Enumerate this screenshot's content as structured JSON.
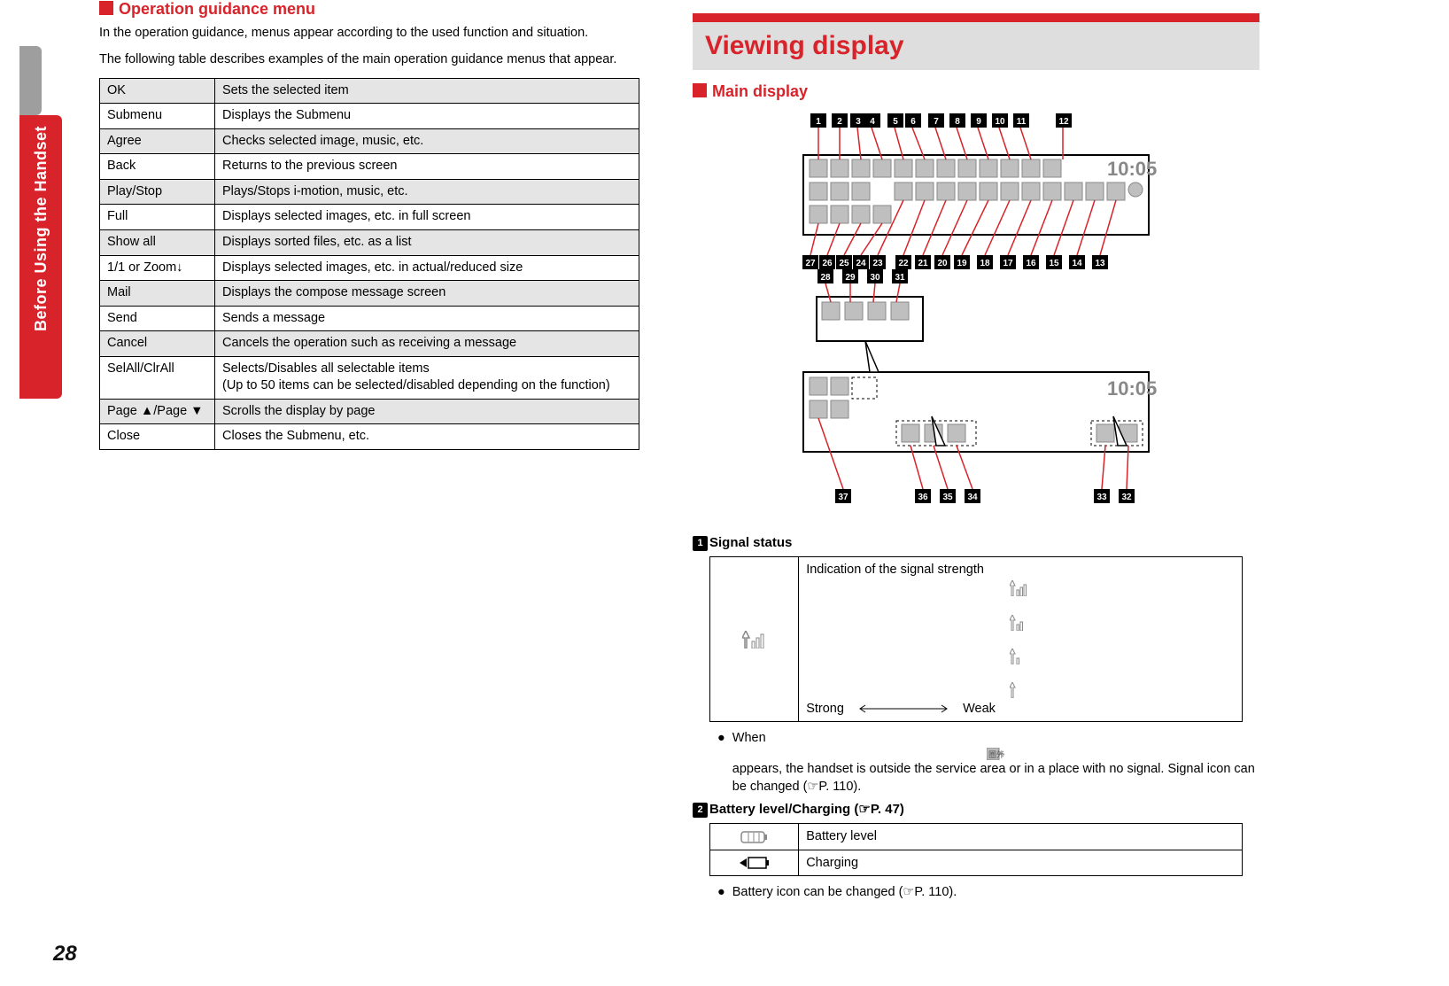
{
  "side_tab": "Before Using the Handset",
  "page_number": "28",
  "left": {
    "heading": "Operation guidance menu",
    "intro1": "In the operation guidance, menus appear according to the used function and situation.",
    "intro2": "The following table describes examples of the main operation guidance menus that appear.",
    "rows": [
      {
        "k": "OK",
        "v": "Sets the selected item"
      },
      {
        "k": "Submenu",
        "v": "Displays the Submenu"
      },
      {
        "k": "Agree",
        "v": "Checks selected image, music, etc."
      },
      {
        "k": "Back",
        "v": "Returns to the previous screen"
      },
      {
        "k": "Play/Stop",
        "v": "Plays/Stops i-motion, music, etc."
      },
      {
        "k": "Full",
        "v": "Displays selected images, etc. in full screen"
      },
      {
        "k": "Show all",
        "v": "Displays sorted files, etc. as a list"
      },
      {
        "k": "1/1 or Zoom↓",
        "v": "Displays selected images, etc. in actual/reduced size"
      },
      {
        "k": "Mail",
        "v": "Displays the compose message screen"
      },
      {
        "k": "Send",
        "v": "Sends a message"
      },
      {
        "k": "Cancel",
        "v": "Cancels the operation such as receiving a message"
      },
      {
        "k": "SelAll/ClrAll",
        "v": "Selects/Disables all selectable items\n(Up to 50 items can be selected/disabled depending on the function)"
      },
      {
        "k": "Page ▲/Page ▼",
        "v": "Scrolls the display by page"
      },
      {
        "k": "Close",
        "v": "Closes the Submenu, etc."
      }
    ]
  },
  "right": {
    "big_heading": "Viewing display",
    "main_display": "Main display",
    "callouts_top": [
      "1",
      "2",
      "3",
      "4",
      "5",
      "6",
      "7",
      "8",
      "9",
      "10",
      "11",
      "12"
    ],
    "callouts_mid": [
      "27",
      "26",
      "25",
      "24",
      "23",
      "22",
      "21",
      "20",
      "19",
      "18",
      "17",
      "16",
      "15",
      "14",
      "13"
    ],
    "callouts_low": [
      "28",
      "29",
      "30",
      "31"
    ],
    "callouts_bottom": [
      "37",
      "36",
      "35",
      "34",
      "33",
      "32"
    ],
    "clock1": "10:05",
    "clock2": "10:05",
    "item1_num": "1",
    "item1_title": "Signal status",
    "signal_desc": "Indication of the signal strength",
    "signal_strong": "Strong",
    "signal_weak": "Weak",
    "bullet1a": "When ",
    "bullet1b": " appears, the handset is outside the service area or in a place with no signal. Signal icon can be changed (☞P. 110).",
    "item2_num": "2",
    "item2_title": "Battery level/Charging (☞P. 47)",
    "batt_level": "Battery level",
    "batt_charging": "Charging",
    "bullet2": "Battery icon can be changed (☞P. 110)."
  }
}
